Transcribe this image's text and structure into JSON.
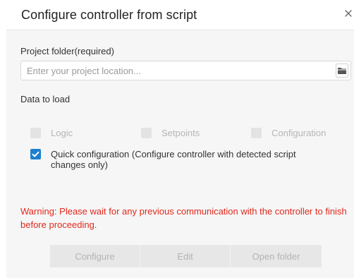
{
  "dialog": {
    "title": "Configure controller from script",
    "close_icon": "close-icon"
  },
  "project_folder": {
    "label": "Project folder(required)",
    "placeholder": "Enter your project location...",
    "value": "",
    "browse_icon": "folder-icon"
  },
  "data_to_load": {
    "label": "Data to load",
    "options": [
      {
        "label": "Logic",
        "checked": false,
        "enabled": false
      },
      {
        "label": "Setpoints",
        "checked": false,
        "enabled": false
      },
      {
        "label": "Configuration",
        "checked": false,
        "enabled": false
      },
      {
        "label": "Quick configuration (Configure controller with detected script changes only)",
        "checked": true,
        "enabled": true
      }
    ]
  },
  "warning": "Warning: Please wait for any previous communication with the controller to finish before proceeding.",
  "buttons": {
    "configure": "Configure",
    "edit": "Edit",
    "open_folder": "Open folder"
  },
  "colors": {
    "accent": "#1f7fce",
    "warning": "#e0281c",
    "body_bg": "#f6f6f6",
    "disabled_text": "#b5b5b5"
  }
}
